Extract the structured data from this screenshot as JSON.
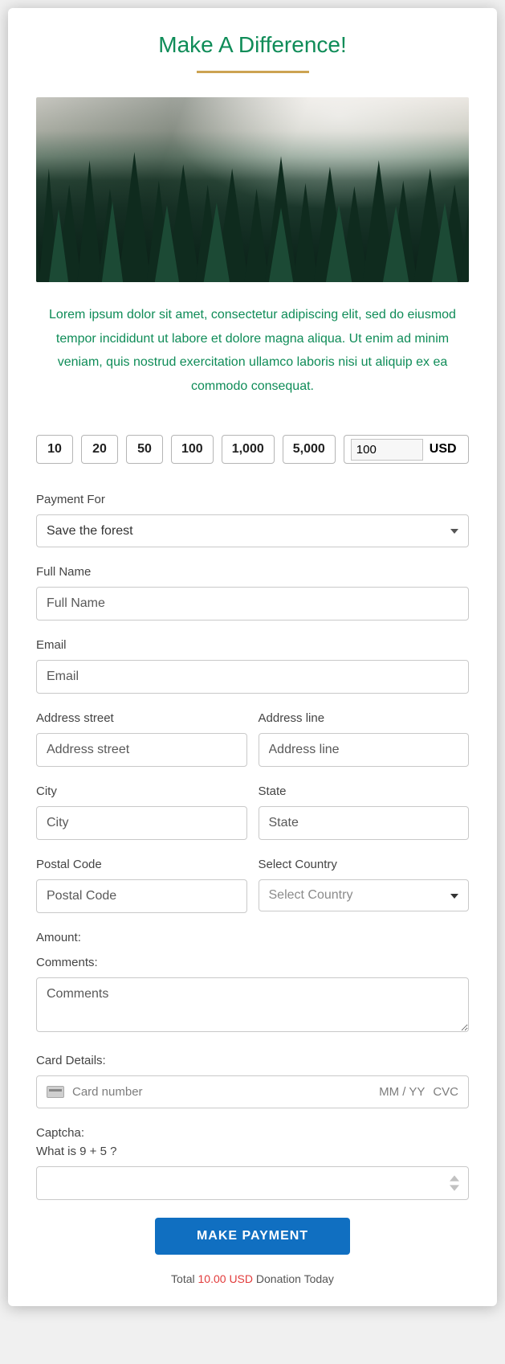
{
  "title": "Make A Difference!",
  "description": "Lorem ipsum dolor sit amet, consectetur adipiscing elit, sed do eiusmod tempor incididunt ut labore et dolore magna aliqua. Ut enim ad minim veniam, quis nostrud exercitation ullamco laboris nisi ut aliquip ex ea commodo consequat.",
  "amount_buttons": [
    "10",
    "20",
    "50",
    "100",
    "1,000",
    "5,000"
  ],
  "custom_amount": {
    "value": "100",
    "currency": "USD"
  },
  "labels": {
    "payment_for": "Payment For",
    "full_name": "Full Name",
    "email": "Email",
    "address_street": "Address street",
    "address_line": "Address line",
    "city": "City",
    "state": "State",
    "postal_code": "Postal Code",
    "select_country": "Select Country",
    "amount": "Amount:",
    "comments": "Comments:",
    "card_details": "Card Details:",
    "captcha": "Captcha:"
  },
  "placeholders": {
    "full_name": "Full Name",
    "email": "Email",
    "address_street": "Address street",
    "address_line": "Address line",
    "city": "City",
    "state": "State",
    "postal_code": "Postal Code",
    "select_country": "Select Country",
    "comments": "Comments",
    "card_number": "Card number",
    "card_exp": "MM / YY",
    "card_cvc": "CVC"
  },
  "payment_for_selected": "Save the forest",
  "captcha_question": "What is 9 + 5 ?",
  "pay_button": "MAKE PAYMENT",
  "footer": {
    "prefix": "Total ",
    "amount": "10.00 USD",
    "suffix": " Donation Today"
  }
}
